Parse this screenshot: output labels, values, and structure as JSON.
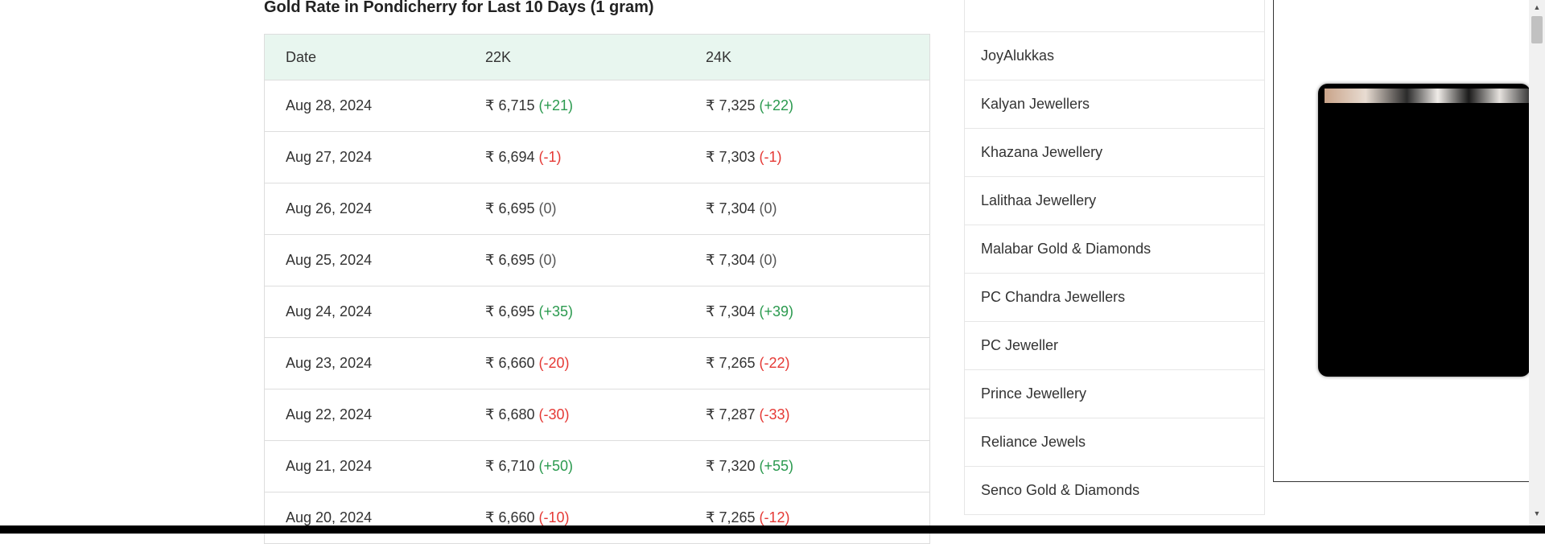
{
  "section_title": "Gold Rate in Pondicherry for Last 10 Days (1 gram)",
  "table": {
    "headers": {
      "date": "Date",
      "k22": "22K",
      "k24": "24K"
    },
    "rows": [
      {
        "date": "Aug 28, 2024",
        "k22": "₹ 6,715",
        "k22_change": "(+21)",
        "k24": "₹ 7,325",
        "k24_change": "(+22)"
      },
      {
        "date": "Aug 27, 2024",
        "k22": "₹ 6,694",
        "k22_change": "(-1)",
        "k24": "₹ 7,303",
        "k24_change": "(-1)"
      },
      {
        "date": "Aug 26, 2024",
        "k22": "₹ 6,695",
        "k22_change": "(0)",
        "k24": "₹ 7,304",
        "k24_change": "(0)"
      },
      {
        "date": "Aug 25, 2024",
        "k22": "₹ 6,695",
        "k22_change": "(0)",
        "k24": "₹ 7,304",
        "k24_change": "(0)"
      },
      {
        "date": "Aug 24, 2024",
        "k22": "₹ 6,695",
        "k22_change": "(+35)",
        "k24": "₹ 7,304",
        "k24_change": "(+39)"
      },
      {
        "date": "Aug 23, 2024",
        "k22": "₹ 6,660",
        "k22_change": "(-20)",
        "k24": "₹ 7,265",
        "k24_change": "(-22)"
      },
      {
        "date": "Aug 22, 2024",
        "k22": "₹ 6,680",
        "k22_change": "(-30)",
        "k24": "₹ 7,287",
        "k24_change": "(-33)"
      },
      {
        "date": "Aug 21, 2024",
        "k22": "₹ 6,710",
        "k22_change": "(+50)",
        "k24": "₹ 7,320",
        "k24_change": "(+55)"
      },
      {
        "date": "Aug 20, 2024",
        "k22": "₹ 6,660",
        "k22_change": "(-10)",
        "k24": "₹ 7,265",
        "k24_change": "(-12)"
      }
    ]
  },
  "jewellers": [
    "",
    "JoyAlukkas",
    "Kalyan Jewellers",
    "Khazana Jewellery",
    "Lalithaa Jewellery",
    "Malabar Gold & Diamonds",
    "PC Chandra Jewellers",
    "PC Jeweller",
    "Prince Jewellery",
    "Reliance Jewels",
    "Senco Gold & Diamonds"
  ],
  "colors": {
    "header_bg": "#e8f6ef",
    "positive": "#2b9a4f",
    "negative": "#e53935",
    "neutral": "#555555"
  }
}
